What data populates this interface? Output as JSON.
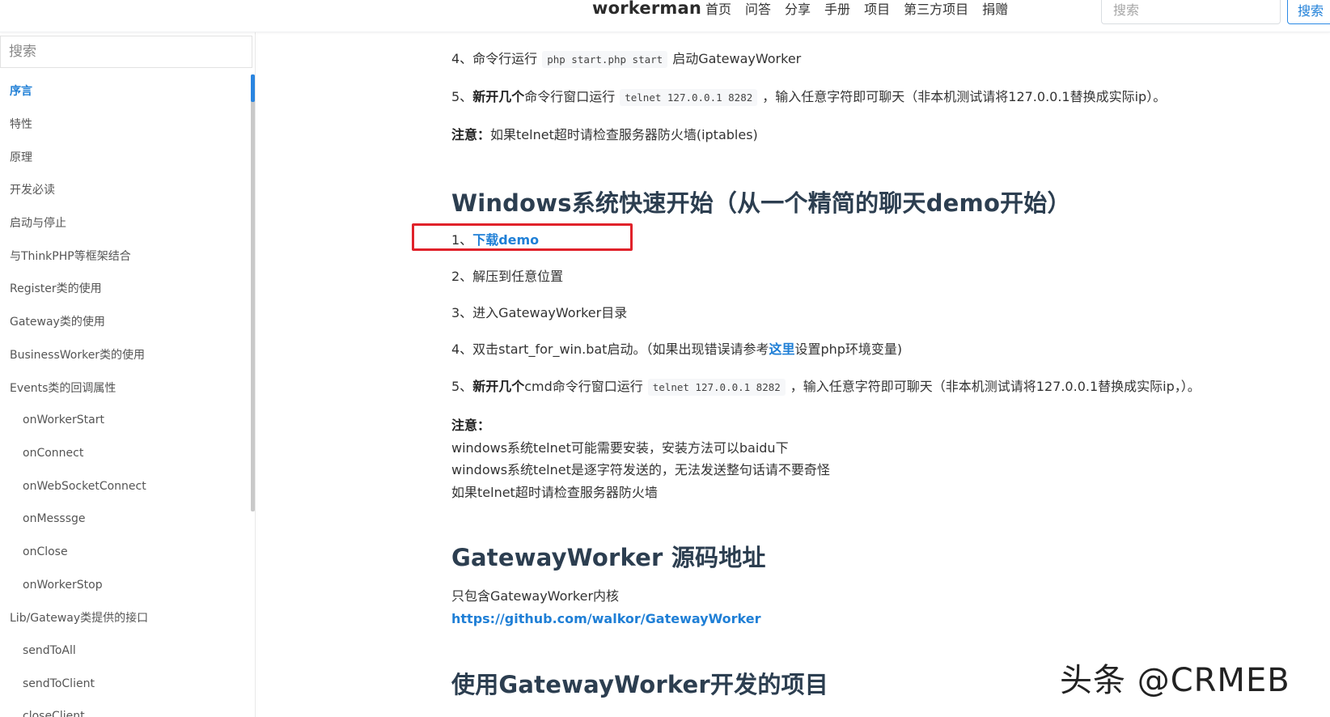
{
  "header": {
    "brand": "workerman",
    "nav": [
      "首页",
      "问答",
      "分享",
      "手册",
      "项目",
      "第三方项目",
      "捐赠"
    ],
    "search_placeholder": "搜索",
    "search_button": "搜索"
  },
  "sidebar": {
    "search_placeholder": "搜索",
    "items": [
      {
        "label": "序言",
        "level": 1,
        "active": true
      },
      {
        "label": "特性",
        "level": 1
      },
      {
        "label": "原理",
        "level": 1
      },
      {
        "label": "开发必读",
        "level": 1
      },
      {
        "label": "启动与停止",
        "level": 1
      },
      {
        "label": "与ThinkPHP等框架结合",
        "level": 1
      },
      {
        "label": "Register类的使用",
        "level": 1
      },
      {
        "label": "Gateway类的使用",
        "level": 1
      },
      {
        "label": "BusinessWorker类的使用",
        "level": 1
      },
      {
        "label": "Events类的回调属性",
        "level": 1
      },
      {
        "label": "onWorkerStart",
        "level": 2
      },
      {
        "label": "onConnect",
        "level": 2
      },
      {
        "label": "onWebSocketConnect",
        "level": 2
      },
      {
        "label": "onMesssge",
        "level": 2
      },
      {
        "label": "onClose",
        "level": 2
      },
      {
        "label": "onWorkerStop",
        "level": 2
      },
      {
        "label": "Lib/Gateway类提供的接口",
        "level": 1
      },
      {
        "label": "sendToAll",
        "level": 2
      },
      {
        "label": "sendToClient",
        "level": 2
      },
      {
        "label": "closeClient",
        "level": 2
      }
    ]
  },
  "content": {
    "linux_step4": {
      "prefix": "4、命令行运行",
      "code": "php start.php start",
      "suffix": "启动GatewayWorker"
    },
    "linux_step5": {
      "num": "5、",
      "bold": "新开几个",
      "mid": "命令行窗口运行",
      "code": "telnet 127.0.0.1 8282",
      "suffix": "，输入任意字符即可聊天（非本机测试请将127.0.0.1替换成实际ip）。"
    },
    "linux_note": {
      "bold": "注意：",
      "text": "如果telnet超时请检查服务器防火墙(iptables)"
    },
    "windows_heading": "Windows系统快速开始（从一个精简的聊天demo开始）",
    "win_step1": {
      "num": "1、",
      "link": "下载demo"
    },
    "win_step2": "2、解压到任意位置",
    "win_step3": "3、进入GatewayWorker目录",
    "win_step4": {
      "prefix": "4、双击start_for_win.bat启动。（如果出现错误请参考",
      "link": "这里",
      "suffix": "设置php环境变量)"
    },
    "win_step5": {
      "num": "5、",
      "bold": "新开几个",
      "mid": "cmd命令行窗口运行",
      "code": "telnet 127.0.0.1 8282",
      "suffix": "，输入任意字符即可聊天（非本机测试请将127.0.0.1替换成实际ip，）。"
    },
    "win_note": {
      "title": "注意：",
      "lines": [
        "windows系统telnet可能需要安装，安装方法可以baidu下",
        "windows系统telnet是逐字符发送的，无法发送整句话请不要奇怪",
        "如果telnet超时请检查服务器防火墙"
      ]
    },
    "source_heading": "GatewayWorker 源码地址",
    "source_desc": "只包含GatewayWorker内核",
    "source_link": "https://github.com/walkor/GatewayWorker",
    "projects_heading": "使用GatewayWorker开发的项目"
  },
  "watermark": "头条 @CRMEB",
  "colors": {
    "accent": "#1f7fd6",
    "highlight_border": "#e0222a",
    "heading": "#2c3e50"
  }
}
